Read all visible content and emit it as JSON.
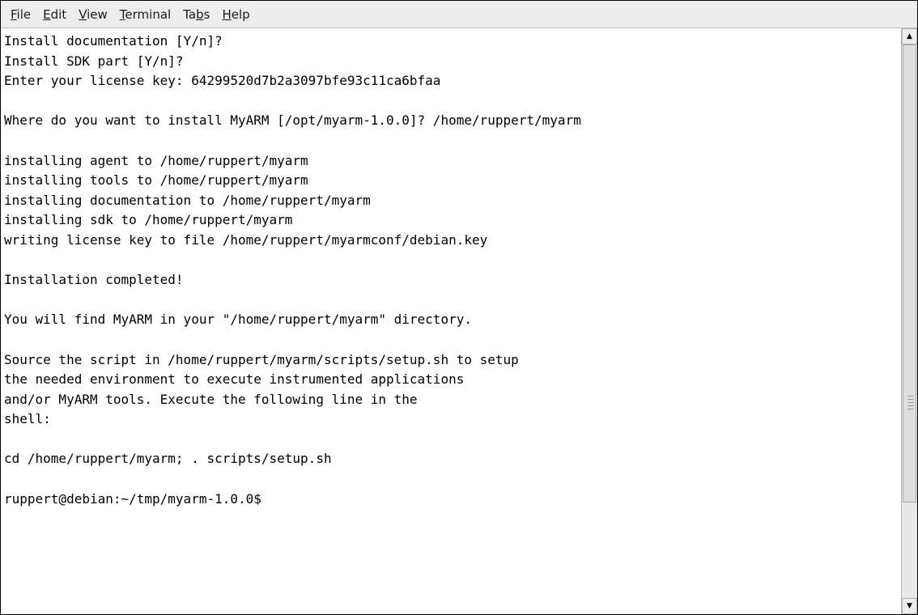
{
  "menubar": {
    "items": [
      {
        "mnemonic": "F",
        "rest": "ile"
      },
      {
        "mnemonic": "E",
        "rest": "dit"
      },
      {
        "mnemonic": "V",
        "rest": "iew"
      },
      {
        "mnemonic": "T",
        "rest": "erminal"
      },
      {
        "prefix": "Ta",
        "mnemonic": "b",
        "rest": "s"
      },
      {
        "mnemonic": "H",
        "rest": "elp"
      }
    ]
  },
  "terminal": {
    "lines": [
      "Install documentation [Y/n]?",
      "Install SDK part [Y/n]?",
      "Enter your license key: 64299520d7b2a3097bfe93c11ca6bfaa",
      "",
      "Where do you want to install MyARM [/opt/myarm-1.0.0]? /home/ruppert/myarm",
      "",
      "installing agent to /home/ruppert/myarm",
      "installing tools to /home/ruppert/myarm",
      "installing documentation to /home/ruppert/myarm",
      "installing sdk to /home/ruppert/myarm",
      "writing license key to file /home/ruppert/myarmconf/debian.key",
      "",
      "Installation completed!",
      "",
      "You will find MyARM in your \"/home/ruppert/myarm\" directory.",
      "",
      "Source the script in /home/ruppert/myarm/scripts/setup.sh to setup",
      "the needed environment to execute instrumented applications",
      "and/or MyARM tools. Execute the following line in the",
      "shell:",
      "",
      "cd /home/ruppert/myarm; . scripts/setup.sh",
      "",
      "ruppert@debian:~/tmp/myarm-1.0.0$"
    ]
  },
  "scrollbar": {
    "up_icon": "triangle-up",
    "down_icon": "triangle-down",
    "up_glyph": "▲",
    "down_glyph": "▼"
  }
}
